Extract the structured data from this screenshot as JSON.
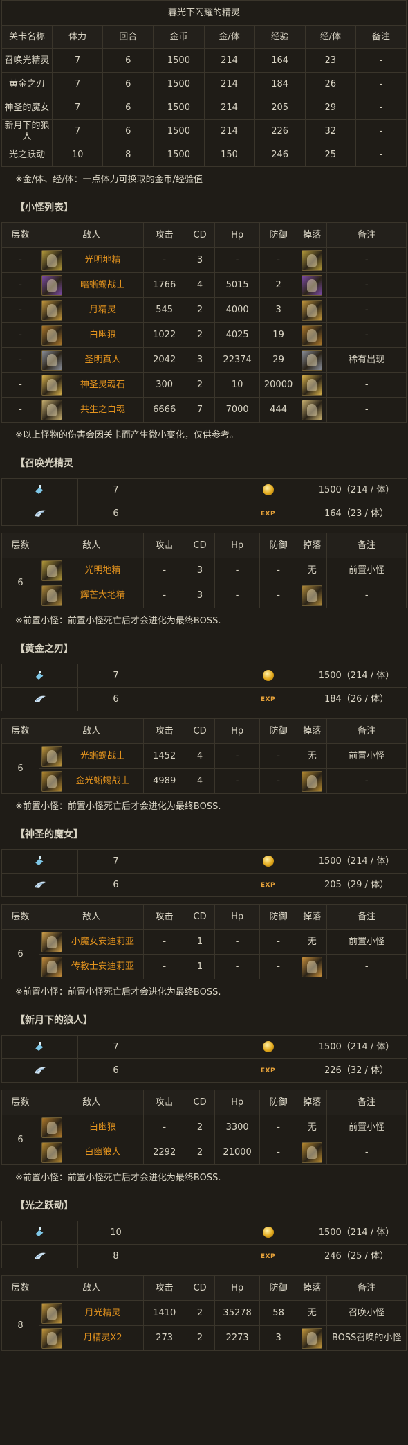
{
  "overview": {
    "title": "暮光下闪耀的精灵",
    "headers": [
      "关卡名称",
      "体力",
      "回合",
      "金币",
      "金/体",
      "经验",
      "经/体",
      "备注"
    ],
    "rows": [
      [
        "召唤光精灵",
        "7",
        "6",
        "1500",
        "214",
        "164",
        "23",
        "-"
      ],
      [
        "黄金之刃",
        "7",
        "6",
        "1500",
        "214",
        "184",
        "26",
        "-"
      ],
      [
        "神圣的魔女",
        "7",
        "6",
        "1500",
        "214",
        "205",
        "29",
        "-"
      ],
      [
        "新月下的狼人",
        "7",
        "6",
        "1500",
        "214",
        "226",
        "32",
        "-"
      ],
      [
        "光之跃动",
        "10",
        "8",
        "1500",
        "150",
        "246",
        "25",
        "-"
      ]
    ],
    "note": "※金/体、经/体：一点体力可换取的金币/经验值"
  },
  "monster_headers": [
    "层数",
    "敌人",
    "攻击",
    "CD",
    "Hp",
    "防御",
    "掉落",
    "备注"
  ],
  "monsters": {
    "title": "【小怪列表】",
    "rows": [
      {
        "floor": "-",
        "name": "光明地精",
        "atk": "-",
        "cd": "3",
        "hp": "-",
        "def": "-",
        "drop": "card",
        "note": "-",
        "color": "#b49a3a"
      },
      {
        "floor": "-",
        "name": "暗蜥蜴战士",
        "atk": "1766",
        "cd": "4",
        "hp": "5015",
        "def": "2",
        "drop": "card",
        "note": "-",
        "color": "#7c4aa6"
      },
      {
        "floor": "-",
        "name": "月精灵",
        "atk": "545",
        "cd": "2",
        "hp": "4000",
        "def": "3",
        "drop": "card",
        "note": "-",
        "color": "#c79a3c"
      },
      {
        "floor": "-",
        "name": "白幽狼",
        "atk": "1022",
        "cd": "2",
        "hp": "4025",
        "def": "19",
        "drop": "card",
        "note": "-",
        "color": "#b07a2a"
      },
      {
        "floor": "-",
        "name": "圣明真人",
        "atk": "2042",
        "cd": "3",
        "hp": "22374",
        "def": "29",
        "drop": "card",
        "note": "稀有出现",
        "color": "#8a8f9a"
      },
      {
        "floor": "-",
        "name": "神圣灵魂石",
        "atk": "300",
        "cd": "2",
        "hp": "10",
        "def": "20000",
        "drop": "card",
        "note": "-",
        "color": "#d6b04a"
      },
      {
        "floor": "-",
        "name": "共生之白魂",
        "atk": "6666",
        "cd": "7",
        "hp": "7000",
        "def": "444",
        "drop": "card",
        "note": "-",
        "color": "#c8b070"
      }
    ],
    "note": "※以上怪物的伤害会因关卡而产生微小变化，仅供参考。"
  },
  "stages": [
    {
      "title": "【召唤光精灵",
      "stamina": "7",
      "turns": "6",
      "gold": "1500（214 / 体）",
      "exp": "164（23 / 体）",
      "floor": "6",
      "rows": [
        {
          "name": "光明地精",
          "atk": "-",
          "cd": "3",
          "hp": "-",
          "def": "-",
          "drop": "无",
          "note": "前置小怪",
          "color": "#b49a3a"
        },
        {
          "name": "辉芒大地精",
          "atk": "-",
          "cd": "3",
          "hp": "-",
          "def": "-",
          "drop": "card",
          "note": "-",
          "color": "#b08a3a"
        }
      ],
      "note": "※前置小怪：前置小怪死亡后才会进化为最终BOSS."
    },
    {
      "title": "【黄金之刃】",
      "stamina": "7",
      "turns": "6",
      "gold": "1500（214 / 体）",
      "exp": "184（26 / 体）",
      "floor": "6",
      "rows": [
        {
          "name": "光蜥蜴战士",
          "atk": "1452",
          "cd": "4",
          "hp": "-",
          "def": "-",
          "drop": "无",
          "note": "前置小怪",
          "color": "#c49b3e"
        },
        {
          "name": "金光蜥蜴战士",
          "atk": "4989",
          "cd": "4",
          "hp": "-",
          "def": "-",
          "drop": "card",
          "note": "-",
          "color": "#b58a30"
        }
      ],
      "note": "※前置小怪：前置小怪死亡后才会进化为最终BOSS."
    },
    {
      "title": "【神圣的魔女】",
      "stamina": "7",
      "turns": "6",
      "gold": "1500（214 / 体）",
      "exp": "205（29 / 体）",
      "floor": "6",
      "rows": [
        {
          "name": "小魔女安迪莉亚",
          "atk": "-",
          "cd": "1",
          "hp": "-",
          "def": "-",
          "drop": "无",
          "note": "前置小怪",
          "color": "#d0a04a"
        },
        {
          "name": "传教士安迪莉亚",
          "atk": "-",
          "cd": "1",
          "hp": "-",
          "def": "-",
          "drop": "card",
          "note": "-",
          "color": "#c9903c"
        }
      ],
      "note": "※前置小怪：前置小怪死亡后才会进化为最终BOSS."
    },
    {
      "title": "【新月下的狼人】",
      "stamina": "7",
      "turns": "6",
      "gold": "1500（214 / 体）",
      "exp": "226（32 / 体）",
      "floor": "6",
      "rows": [
        {
          "name": "白幽狼",
          "atk": "-",
          "cd": "2",
          "hp": "3300",
          "def": "-",
          "drop": "无",
          "note": "前置小怪",
          "color": "#b07a2a"
        },
        {
          "name": "白幽狼人",
          "atk": "2292",
          "cd": "2",
          "hp": "21000",
          "def": "-",
          "drop": "card",
          "note": "-",
          "color": "#b88a30"
        }
      ],
      "note": "※前置小怪：前置小怪死亡后才会进化为最终BOSS."
    },
    {
      "title": "【光之跃动】",
      "stamina": "10",
      "turns": "8",
      "gold": "1500（214 / 体）",
      "exp": "246（25 / 体）",
      "floor": "8",
      "rows": [
        {
          "name": "月光精灵",
          "atk": "1410",
          "cd": "2",
          "hp": "35278",
          "def": "58",
          "drop": "无",
          "note": "召唤小怪",
          "color": "#c79a3c"
        },
        {
          "name": "月精灵X2",
          "atk": "273",
          "cd": "2",
          "hp": "2273",
          "def": "3",
          "drop": "card",
          "note": "BOSS召唤的小怪",
          "color": "#c79a3c"
        }
      ],
      "note": ""
    }
  ],
  "icons": {
    "stamina": "potion-icon",
    "turns": "wing-icon",
    "gold": "coin-icon",
    "exp_label": "EXP"
  }
}
